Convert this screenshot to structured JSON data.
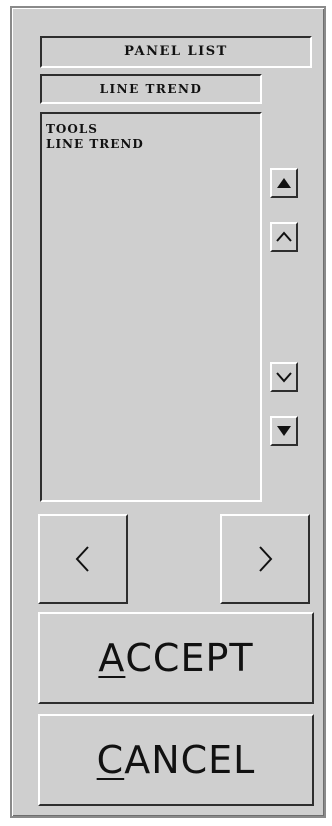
{
  "panel": {
    "title": "PANEL LIST",
    "selected": "LINE TREND",
    "items": [
      {
        "label": "TOOLS"
      },
      {
        "label": "LINE TREND"
      }
    ]
  },
  "scroll": {
    "top_icon": "arrow-top-icon",
    "up_icon": "chevron-up-icon",
    "down_icon": "chevron-down-icon",
    "bottom_icon": "arrow-bottom-icon"
  },
  "nav": {
    "prev_icon": "chevron-left-icon",
    "next_icon": "chevron-right-icon"
  },
  "buttons": {
    "accept": {
      "mnemonic": "A",
      "rest": "CCEPT"
    },
    "cancel": {
      "mnemonic": "C",
      "rest": "ANCEL"
    }
  },
  "colors": {
    "panel_bg": "#cfcfcf",
    "highlight": "#ffffff",
    "shadow": "#2e2e2e",
    "text": "#111111"
  }
}
